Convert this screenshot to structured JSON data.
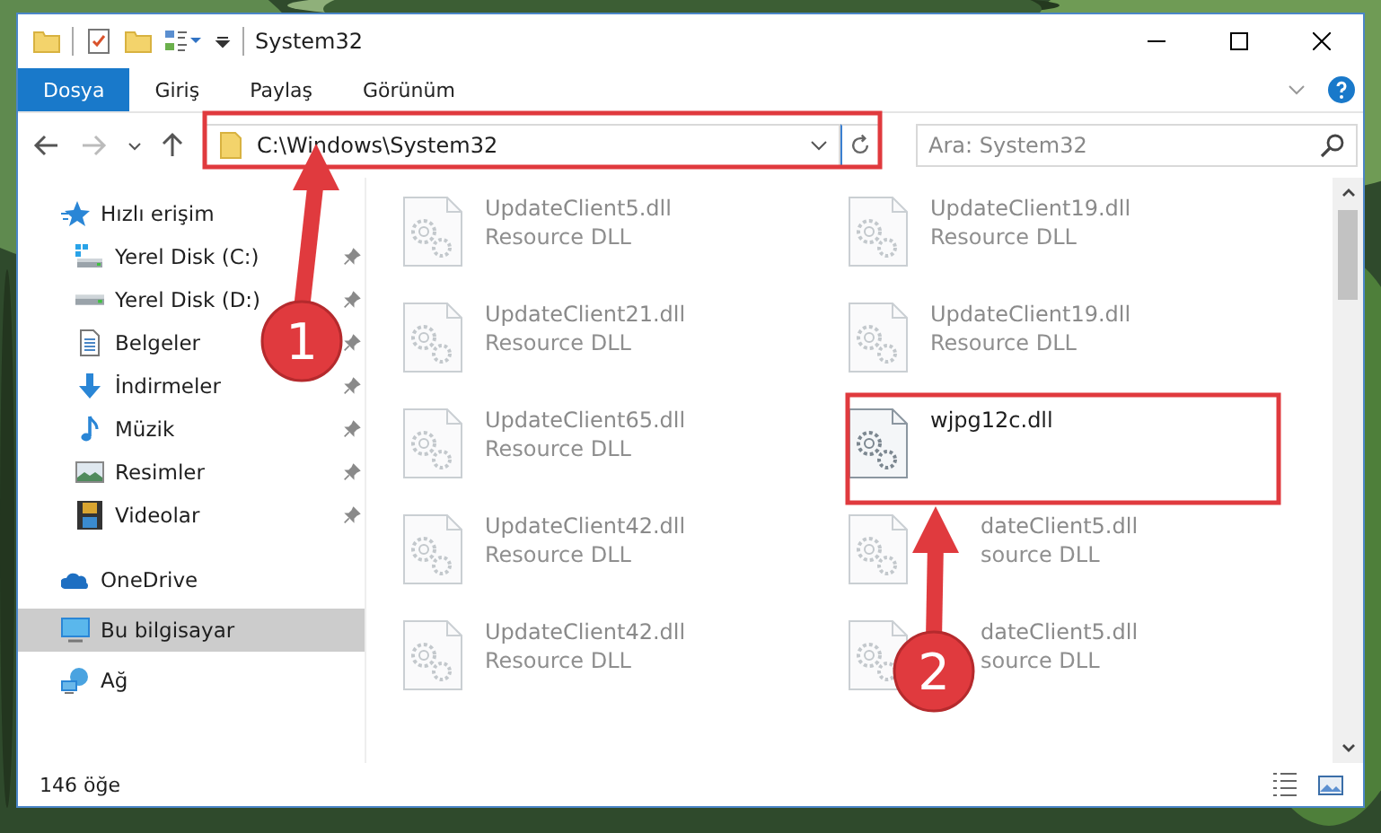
{
  "window": {
    "title": "System32"
  },
  "ribbon_tabs": [
    {
      "label": "Dosya",
      "selected": true
    },
    {
      "label": "Giriş",
      "selected": false
    },
    {
      "label": "Paylaş",
      "selected": false
    },
    {
      "label": "Görünüm",
      "selected": false
    }
  ],
  "address_bar": {
    "path": "C:\\Windows\\System32"
  },
  "search": {
    "placeholder": "Ara: System32"
  },
  "sidebar": {
    "items": [
      {
        "label": "Hızlı erişim",
        "kind": "star",
        "selected": false,
        "children": [
          {
            "label": "Yerel Disk (C:)",
            "kind": "drive-c",
            "pinned": true,
            "selected": false
          },
          {
            "label": "Yerel Disk (D:)",
            "kind": "drive",
            "pinned": true,
            "selected": false
          },
          {
            "label": "Belgeler",
            "kind": "documents",
            "pinned": true,
            "selected": false
          },
          {
            "label": "İndirmeler",
            "kind": "downloads",
            "pinned": true,
            "selected": false
          },
          {
            "label": "Müzik",
            "kind": "music",
            "pinned": true,
            "selected": false
          },
          {
            "label": "Resimler",
            "kind": "pictures",
            "pinned": true,
            "selected": false
          },
          {
            "label": "Videolar",
            "kind": "videos",
            "pinned": true,
            "selected": false
          }
        ]
      },
      {
        "label": "OneDrive",
        "kind": "cloud",
        "selected": false
      },
      {
        "label": "Bu bilgisayar",
        "kind": "computer",
        "selected": true
      },
      {
        "label": "Ağ",
        "kind": "network",
        "selected": false
      }
    ]
  },
  "files": [
    {
      "name": "UpdateClient5.dll",
      "type": "Resource DLL",
      "blurred": true,
      "covered": false
    },
    {
      "name": "UpdateClient19.dll",
      "type": "Resource DLL",
      "blurred": true,
      "covered": false
    },
    {
      "name": "UpdateClient21.dll",
      "type": "Resource DLL",
      "blurred": true,
      "covered": false
    },
    {
      "name": "UpdateClient19.dll",
      "type": "Resource DLL",
      "blurred": true,
      "covered": false
    },
    {
      "name": "UpdateClient65.dll",
      "type": "Resource DLL",
      "blurred": true,
      "covered": false
    },
    {
      "name": "wjpg12c.dll",
      "blurred": false,
      "covered": false
    },
    {
      "name": "UpdateClient42.dll",
      "type": "Resource DLL",
      "blurred": true,
      "covered": false
    },
    {
      "name": "dateClient5.dll",
      "type": "source DLL",
      "blurred": true,
      "covered": true
    },
    {
      "name": "UpdateClient42.dll",
      "type": "Resource DLL",
      "blurred": true,
      "covered": false
    },
    {
      "name": "dateClient5.dll",
      "type": "source DLL",
      "blurred": true,
      "covered": true
    }
  ],
  "status_bar": {
    "item_count": "146 öğe"
  },
  "annotations": [
    {
      "label": "1"
    },
    {
      "label": "2"
    }
  ]
}
